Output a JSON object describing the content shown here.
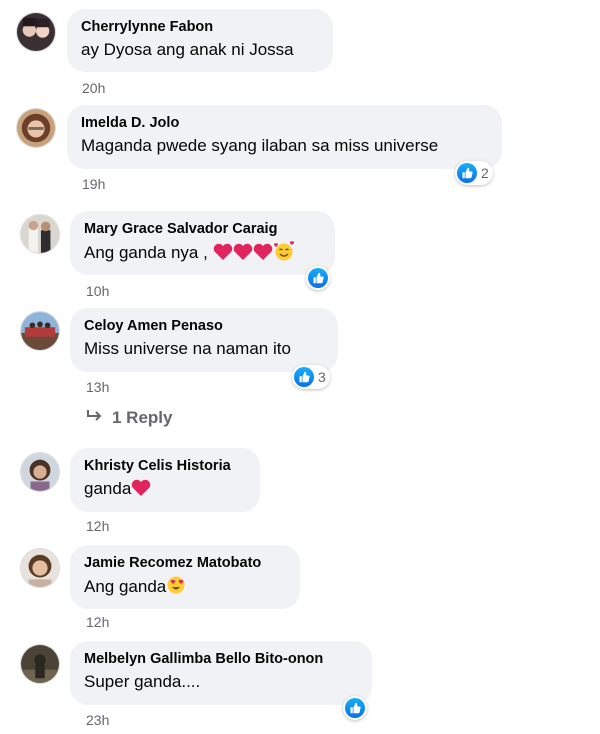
{
  "comments": [
    {
      "name": "Cherrylynne Fabon",
      "text": "ay Dyosa ang anak ni Jossa",
      "time": "20h",
      "likes": ""
    },
    {
      "name": "Imelda D. Jolo",
      "text": "Maganda pwede syang ilaban sa miss universe",
      "time": "19h",
      "likes": "2"
    },
    {
      "name": "Mary Grace Salvador Caraig",
      "text": "Ang ganda nya ,",
      "time": "10h",
      "likes": ""
    },
    {
      "name": "Celoy Amen Penaso",
      "text": "Miss universe na naman ito",
      "time": "13h",
      "likes": "3"
    },
    {
      "name": "Khristy Celis Historia",
      "text": "ganda",
      "time": "12h",
      "likes": ""
    },
    {
      "name": "Jamie Recomez Matobato",
      "text": "Ang ganda",
      "time": "12h",
      "likes": ""
    },
    {
      "name": "Melbelyn Gallimba Bello Bito-onon",
      "text": "Super ganda....",
      "time": "23h",
      "likes": ""
    }
  ],
  "reply_link": "1 Reply",
  "icons": [
    "like-icon",
    "red-heart-icon",
    "smiling-face-with-hearts-icon",
    "heart-eyes-emoji-icon",
    "reply-arrow-icon"
  ],
  "colors": {
    "bubble": "#f0f2f5",
    "like_blue": "#1877f2",
    "heart_red": "#e0245e",
    "meta_gray": "#65676b"
  }
}
